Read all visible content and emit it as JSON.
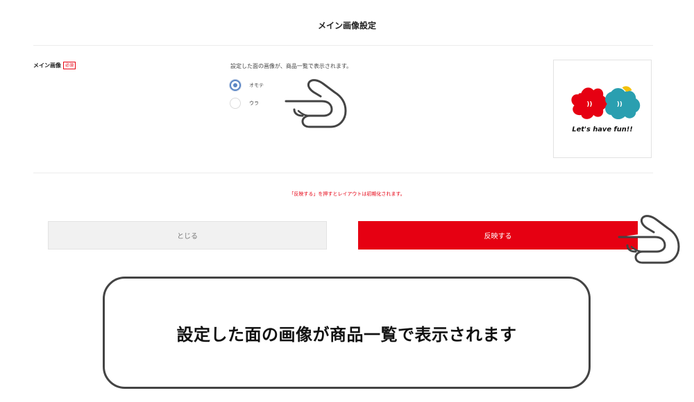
{
  "page": {
    "title": "メイン画像設定"
  },
  "main_image": {
    "label": "メイン画像",
    "required_badge": "必須",
    "description": "設定した面の画像が、商品一覧で表示されます。",
    "options": [
      {
        "label": "オモテ",
        "selected": true
      },
      {
        "label": "ウラ",
        "selected": false
      }
    ],
    "preview": {
      "caption": "Let's have fun!!"
    }
  },
  "notice": "「反映する」を押すとレイアウトは初期化されます。",
  "buttons": {
    "close_label": "とじる",
    "apply_label": "反映する"
  },
  "callout": {
    "text": "設定した面の画像が商品一覧で表示されます"
  },
  "colors": {
    "accent_red": "#e60012",
    "radio_blue": "#5b86c4",
    "close_bg": "#f1f1f1"
  },
  "icons": [
    "pointing-hand-icon",
    "radio-checked-icon",
    "radio-unchecked-icon"
  ]
}
